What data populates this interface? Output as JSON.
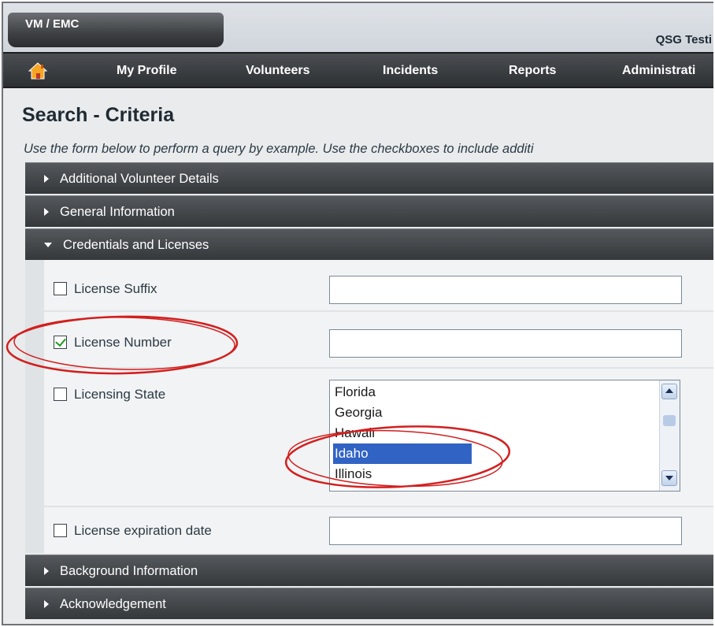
{
  "app": {
    "tab_label": "VM / EMC",
    "title": "QSG Testi"
  },
  "nav": {
    "home_icon": "home-icon",
    "items": [
      {
        "label": "My Profile"
      },
      {
        "label": "Volunteers"
      },
      {
        "label": "Incidents"
      },
      {
        "label": "Reports"
      },
      {
        "label": "Administrati"
      }
    ]
  },
  "page": {
    "title": "Search - Criteria",
    "instructions": "Use the form below to perform a query by example. Use the checkboxes to include additi"
  },
  "sections": {
    "additional": {
      "label": "Additional Volunteer Details",
      "expanded": false
    },
    "general": {
      "label": "General Information",
      "expanded": false
    },
    "credentials": {
      "label": "Credentials and Licenses",
      "expanded": true
    },
    "background": {
      "label": "Background Information",
      "expanded": false
    },
    "acknowledgement": {
      "label": "Acknowledgement",
      "expanded": false
    }
  },
  "fields": {
    "license_suffix": {
      "label": "License Suffix",
      "checked": false,
      "value": ""
    },
    "license_number": {
      "label": "License Number",
      "checked": true,
      "value": ""
    },
    "licensing_state": {
      "label": "Licensing State",
      "checked": false,
      "options": [
        "Florida",
        "Georgia",
        "Hawaii",
        "Idaho",
        "Illinois"
      ],
      "selected": "Idaho"
    },
    "license_expiration": {
      "label": "License expiration date",
      "checked": false,
      "value": ""
    }
  },
  "colors": {
    "nav_bg": "#3a3d40",
    "selection": "#3163c4",
    "annotation": "#d21f1f",
    "checkmark": "#1d9a1d"
  }
}
